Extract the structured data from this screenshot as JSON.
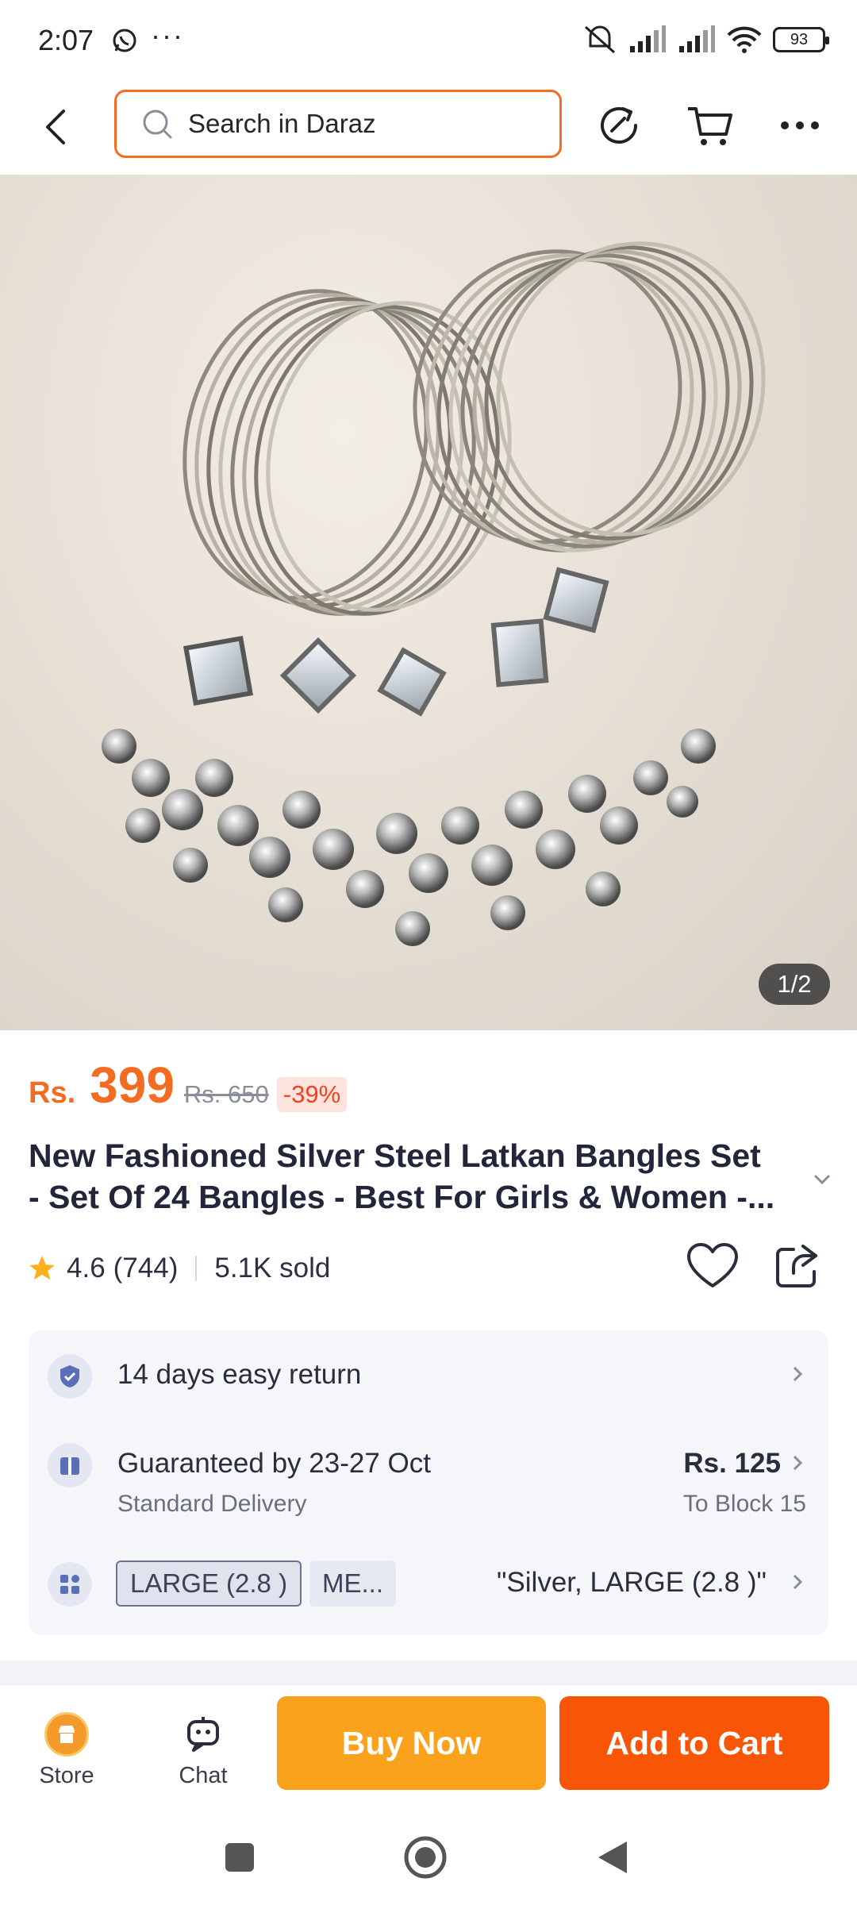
{
  "status_bar": {
    "time": "2:07",
    "overflow": "···",
    "battery": "93",
    "icons": [
      "whatsapp-icon",
      "mute-icon",
      "signal-icon",
      "signal-icon",
      "wifi-icon",
      "battery-icon"
    ]
  },
  "header": {
    "search_placeholder": "Search in Daraz",
    "icons": [
      "back-arrow-icon",
      "search-icon",
      "refresh-share-icon",
      "cart-icon",
      "more-dots-icon"
    ]
  },
  "gallery": {
    "counter": "1/2"
  },
  "product": {
    "currency": "Rs.",
    "price": "399",
    "old_price": "Rs. 650",
    "discount": "-39%",
    "title_line1": "New Fashioned Silver Steel Latkan Bangles Set",
    "title_line2": "- Set Of 24 Bangles - Best For Girls & Women -...",
    "rating": "4.6",
    "reviews": "(744)",
    "sold": "5.1K sold"
  },
  "info": {
    "return_text": "14 days easy return",
    "delivery_text": "Guaranteed by 23-27 Oct",
    "delivery_sub": "Standard Delivery",
    "delivery_price": "Rs. 125",
    "delivery_dest": "To Block 15",
    "variant_chip_1": "LARGE (2.8 )",
    "variant_chip_2": "ME...",
    "variant_selected": "\"Silver, LARGE (2.8 )\""
  },
  "bottom_bar": {
    "store_label": "Store",
    "chat_label": "Chat",
    "buy_now": "Buy Now",
    "add_to_cart": "Add to Cart"
  },
  "colors": {
    "accent": "#f85606",
    "price": "#f36c21",
    "buy_now": "#fba21c"
  }
}
